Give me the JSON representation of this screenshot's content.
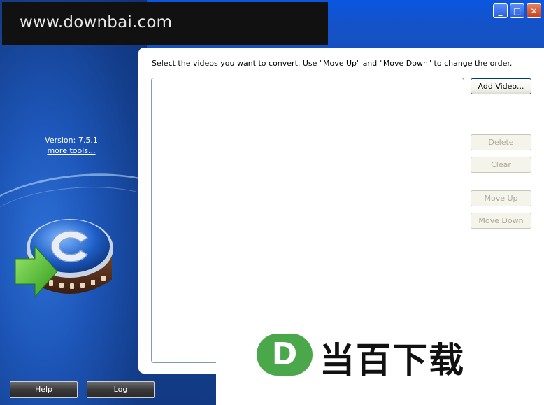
{
  "window": {
    "controls": {
      "minimize": "_",
      "maximize": "□",
      "close": "✕"
    }
  },
  "watermark": {
    "top_text": "www.downbai.com",
    "bottom_logo_letter": "D",
    "bottom_text": "当百下载"
  },
  "sidebar": {
    "version": "Version: 7.5.1",
    "more_tools": "more tools..."
  },
  "main": {
    "instructions": "Select the videos you want to convert. Use \"Move Up\" and \"Move Down\" to change the order.",
    "buttons": {
      "add_video": "Add Video...",
      "delete": "Delete",
      "clear": "Clear",
      "move_up": "Move Up",
      "move_down": "Move Down"
    },
    "video_list": []
  },
  "footer": {
    "help": "Help",
    "log": "Log"
  },
  "colors": {
    "brand_blue": "#1a4fb0",
    "arrow_green": "#3aa83a",
    "close_red": "#c8401c"
  },
  "icons": [
    "minimize-icon",
    "maximize-icon",
    "close-icon",
    "app-logo-icon"
  ]
}
